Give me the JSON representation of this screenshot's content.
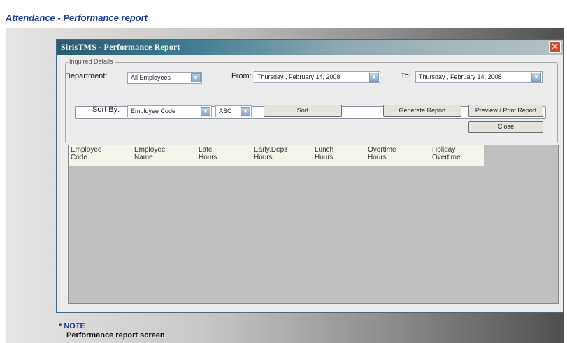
{
  "page": {
    "heading": "Attendance - Performance report",
    "note_title": "* NOTE",
    "note_text": "Performance report screen"
  },
  "dialog": {
    "title": "SirisTMS - Performance Report",
    "close_glyph": "✕",
    "group_label": "Inquired Details",
    "department_label": "Department:",
    "department_value": "All Employees",
    "from_label": "From:",
    "from_value": "Thursday , February 14, 2008",
    "to_label": "To:",
    "to_value": "Thursday , February 14, 2008",
    "sort_by_label": "Sort By:",
    "sort_by_value": "Employee Code",
    "order_value": "ASC",
    "sort_button": "Sort",
    "generate_button": "Generate Report",
    "preview_button": "Preview / Print Report",
    "close_button": "Close",
    "dropdown_glyph": "▼"
  },
  "grid": {
    "columns": [
      "Employee\nCode",
      "Employee\nName",
      "Late\nHours",
      "Early.Deps\nHours",
      "Lunch\nHours",
      "Overtime\nHours",
      "Holiday\nOvertime"
    ],
    "rows": []
  }
}
